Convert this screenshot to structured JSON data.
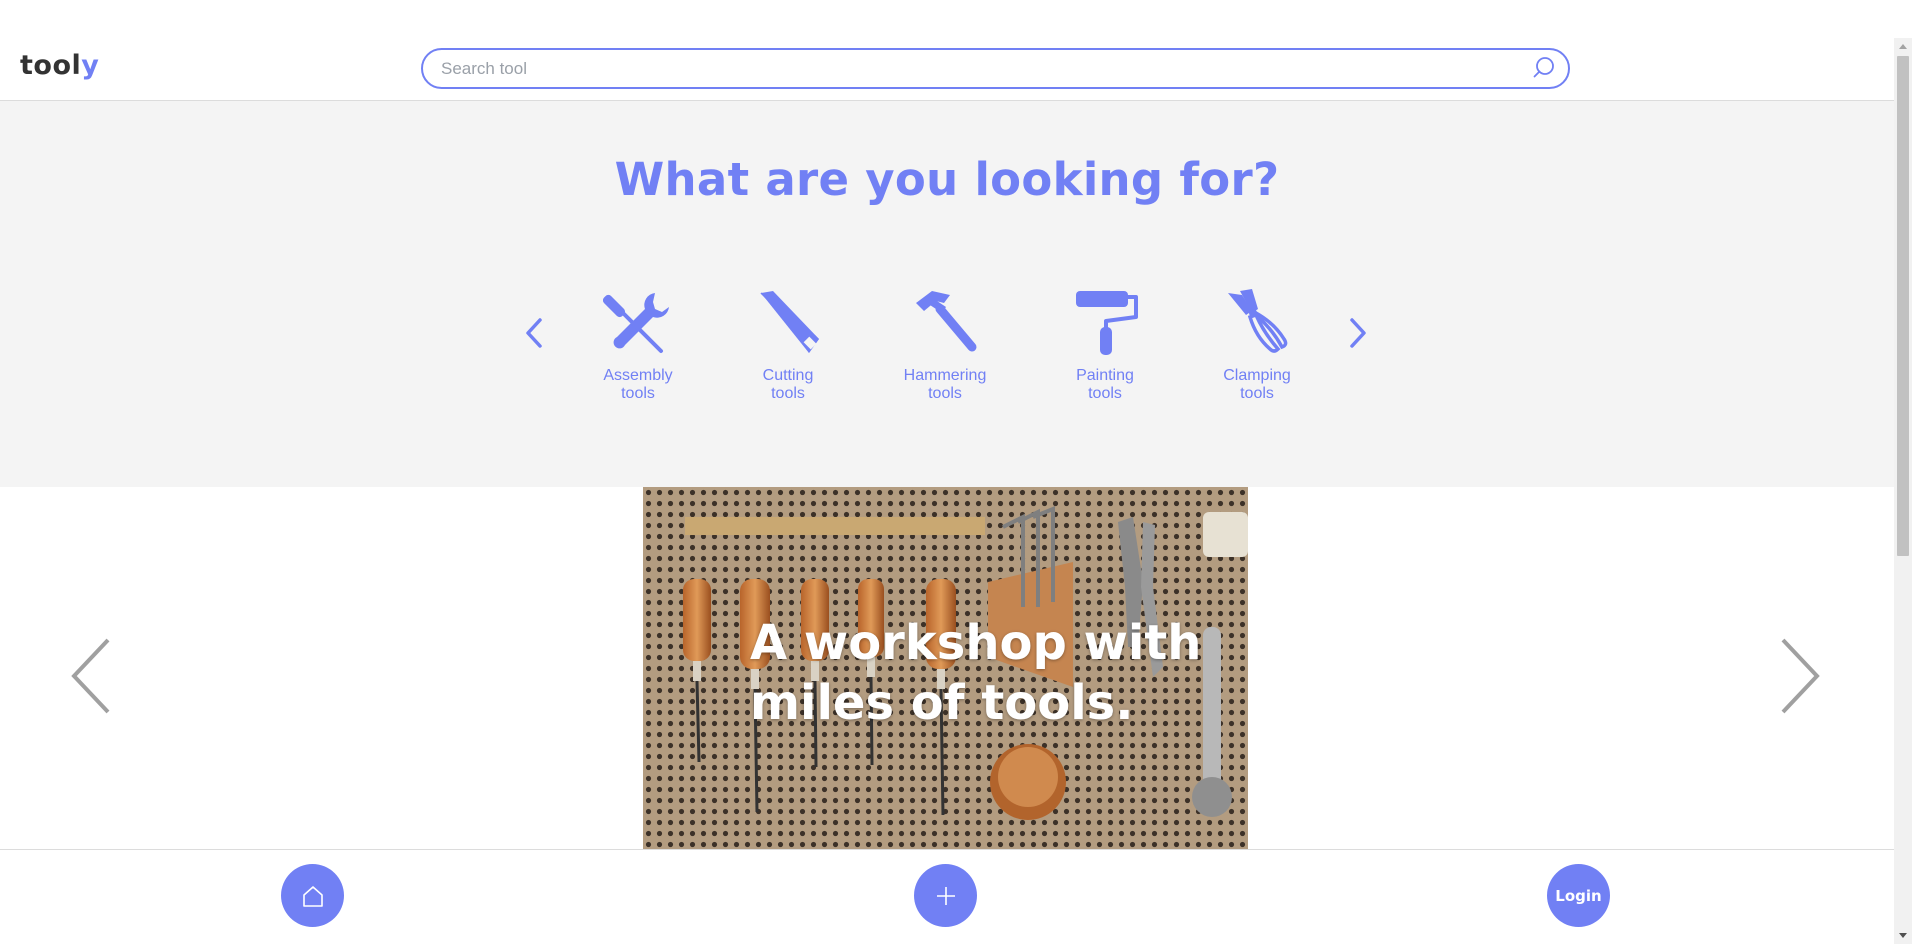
{
  "header": {
    "logo_main": "tool",
    "logo_accent": "y",
    "search": {
      "placeholder": "Search tool",
      "value": "",
      "icon": "search-icon"
    }
  },
  "categories": {
    "title": "What are you looking for?",
    "prev_icon": "chevron-left-icon",
    "next_icon": "chevron-right-icon",
    "items": [
      {
        "line1": "Assembly",
        "line2": "tools",
        "icon": "wrench-screwdriver-icon"
      },
      {
        "line1": "Cutting",
        "line2": "tools",
        "icon": "handsaw-icon"
      },
      {
        "line1": "Hammering",
        "line2": "tools",
        "icon": "hammer-icon"
      },
      {
        "line1": "Painting",
        "line2": "tools",
        "icon": "paint-roller-icon"
      },
      {
        "line1": "Clamping",
        "line2": "tools",
        "icon": "pliers-icon"
      }
    ]
  },
  "hero": {
    "line1": "A workshop with",
    "line2": "miles of tools.",
    "prev_icon": "chevron-left-icon",
    "next_icon": "chevron-right-icon"
  },
  "bottom_nav": {
    "home_icon": "home-icon",
    "add_icon": "plus-icon",
    "login_label": "Login"
  },
  "colors": {
    "accent": "#7180f4",
    "band_background": "#f4f4f4",
    "logo_text": "#333333"
  }
}
